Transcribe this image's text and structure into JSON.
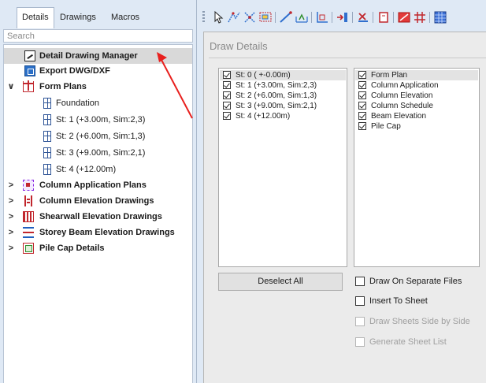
{
  "tabs": [
    {
      "label": "Details",
      "active": true
    },
    {
      "label": "Drawings",
      "active": false
    },
    {
      "label": "Macros",
      "active": false
    }
  ],
  "search": {
    "placeholder": "Search",
    "value": ""
  },
  "tree": {
    "detail_drawing_manager": "Detail Drawing Manager",
    "export": "Export DWG/DXF",
    "form_plans": "Form Plans",
    "form_children": [
      "Foundation",
      "St: 1 (+3.00m, Sim:2,3)",
      "St: 2 (+6.00m, Sim:1,3)",
      "St: 3 (+9.00m, Sim:2,1)",
      "St: 4 (+12.00m)"
    ],
    "column_application_plans": "Column Application Plans",
    "column_elevation_drawings": "Column Elevation Drawings",
    "shearwall_elevation_drawings": "Shearwall Elevation Drawings",
    "storey_beam_elevation_drawings": "Storey Beam Elevation Drawings",
    "pile_cap_details": "Pile Cap Details",
    "expand_collapse_glyphs": {
      "expanded": "∨",
      "collapsed": ">"
    }
  },
  "panel": {
    "title": "Draw Details",
    "storeys": [
      {
        "label": "St: 0 ( +-0.00m)",
        "checked": true
      },
      {
        "label": "St: 1 (+3.00m, Sim:2,3)",
        "checked": true
      },
      {
        "label": "St: 2 (+6.00m, Sim:1,3)",
        "checked": true
      },
      {
        "label": "St: 3 (+9.00m, Sim:2,1)",
        "checked": true
      },
      {
        "label": "St: 4 (+12.00m)",
        "checked": true
      }
    ],
    "drawing_types": [
      {
        "label": "Form Plan",
        "checked": true
      },
      {
        "label": "Column Application",
        "checked": true
      },
      {
        "label": "Column Elevation",
        "checked": true
      },
      {
        "label": "Column Schedule",
        "checked": true
      },
      {
        "label": "Beam Elevation",
        "checked": true
      },
      {
        "label": "Pile Cap",
        "checked": true
      }
    ],
    "deselect_all": "Deselect All",
    "options": [
      {
        "label": "Draw On Separate Files",
        "checked": false,
        "enabled": true
      },
      {
        "label": "Insert To Sheet",
        "checked": false,
        "enabled": true
      },
      {
        "label": "Draw Sheets Side by Side",
        "checked": false,
        "enabled": false
      },
      {
        "label": "Generate Sheet List",
        "checked": false,
        "enabled": false
      }
    ]
  },
  "colors": {
    "background": "#dfe9f5",
    "selected_row": "#d9d9d9",
    "annotation_arrow": "#e8201e",
    "disabled_text": "#a0a0a0"
  },
  "toolbar_icons": [
    "select-pointer-icon",
    "polyline-select-icon",
    "crossing-select-icon",
    "window-select-icon",
    "draw-line-icon",
    "dimension-icon",
    "axis-icon",
    "insert-icon",
    "delete-beam-icon",
    "rectangle-icon",
    "red-slab-icon",
    "grid-icon",
    "table-icon"
  ]
}
